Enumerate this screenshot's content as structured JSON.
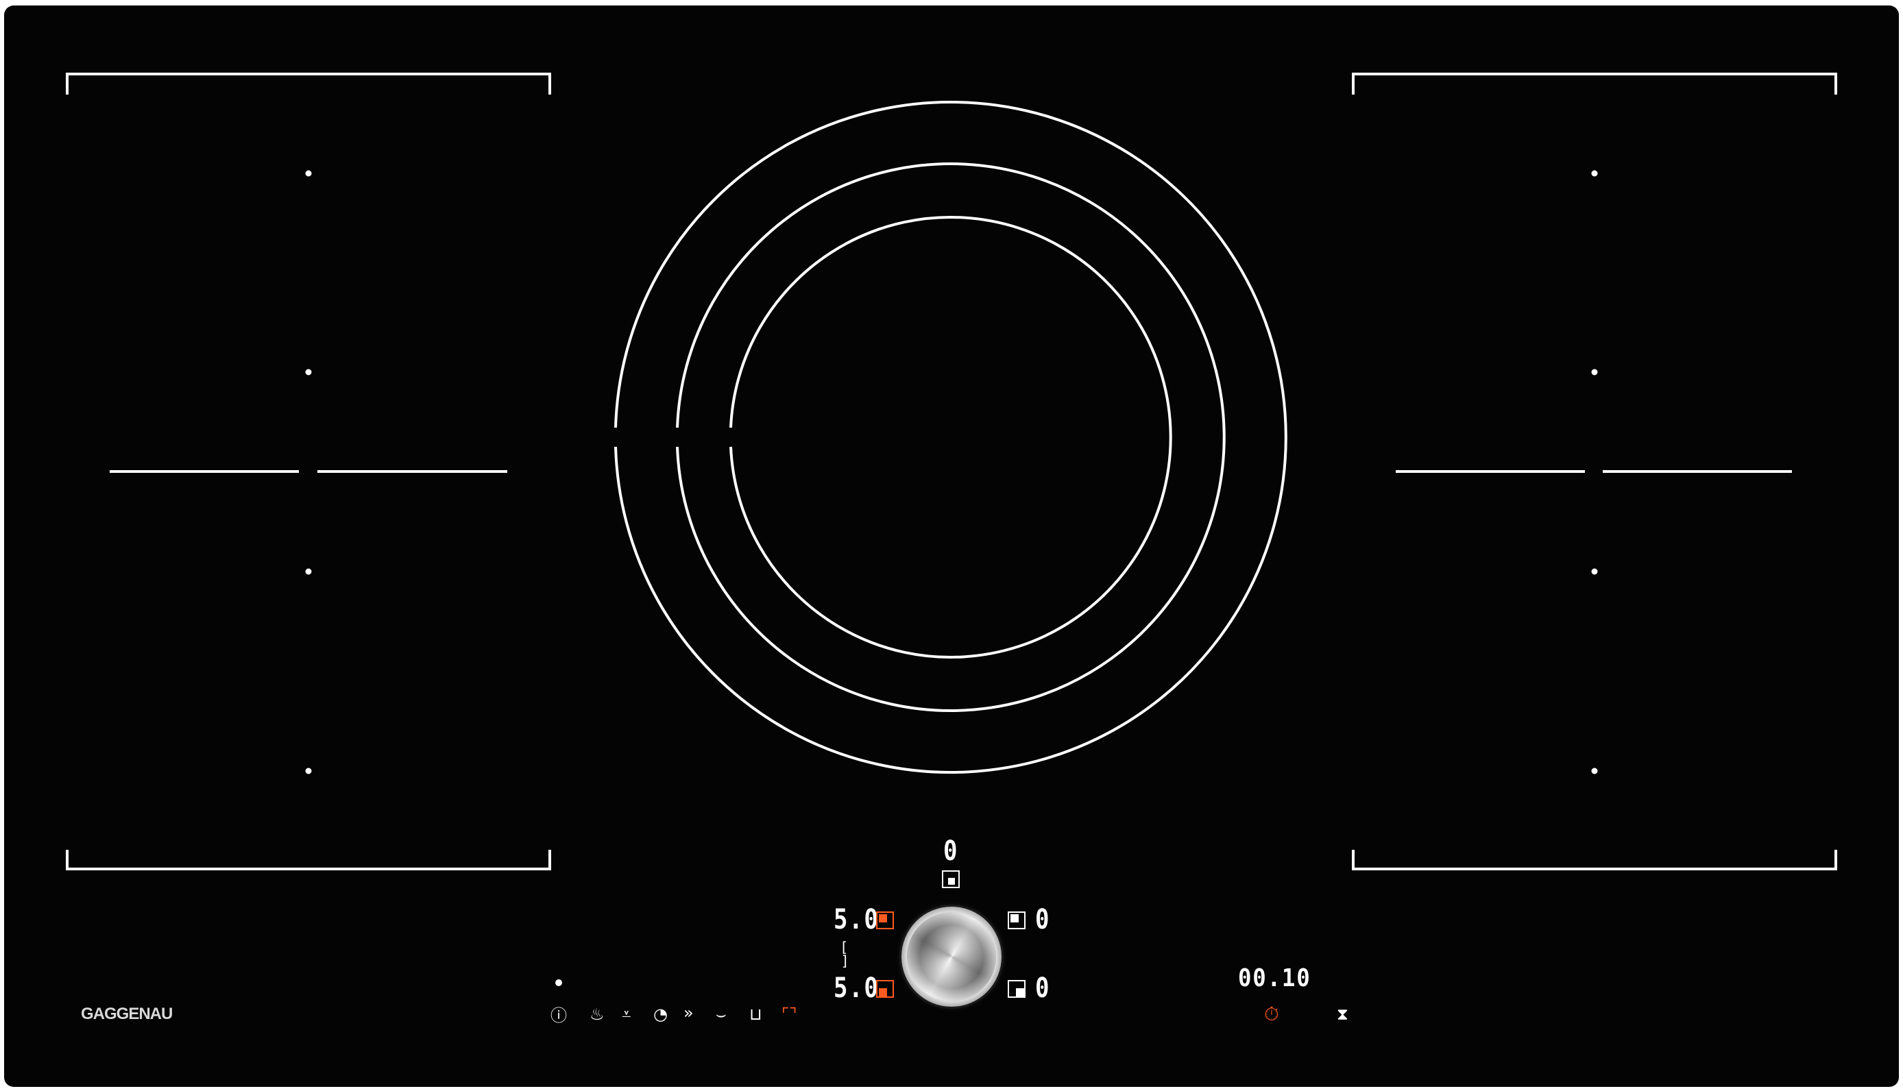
{
  "brand": {
    "name": "GAGGENAU"
  },
  "colors": {
    "surface": "#040404",
    "lines": "#ffffff",
    "accent": "#ff5a1f"
  },
  "center_zone": {
    "top_level": "0",
    "top_left_level": "5.0",
    "bottom_left_level": "5.0",
    "top_right_level": "0",
    "bottom_right_level": "0",
    "top_left_active": true,
    "bottom_left_active": true
  },
  "timer": {
    "display": "00.10"
  },
  "function_icons": [
    "info-icon",
    "pot-steam-icon",
    "frying-pan-icon",
    "keep-warm-icon",
    "boost-icon",
    "pan-frying-sensor-icon",
    "cooking-sensor-icon",
    "flex-zone-icon"
  ],
  "timer_icons": [
    "stopwatch-icon",
    "hourglass-icon"
  ]
}
